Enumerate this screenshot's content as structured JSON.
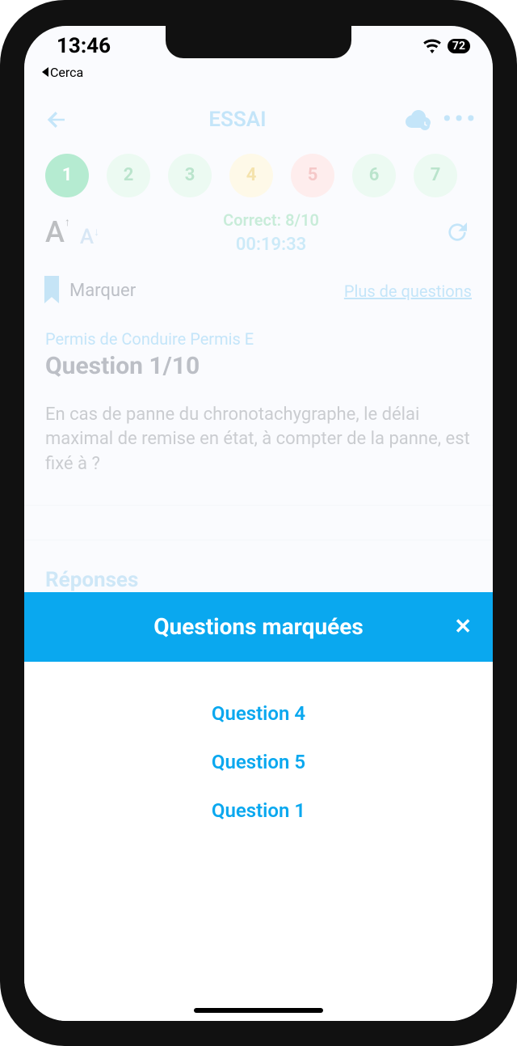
{
  "status": {
    "time": "13:46",
    "battery": "72",
    "back_app": "Cerca"
  },
  "header": {
    "title": "ESSAI"
  },
  "pills": [
    {
      "n": "1",
      "cls": "pill-solid"
    },
    {
      "n": "2",
      "cls": "pill-g"
    },
    {
      "n": "3",
      "cls": "pill-g"
    },
    {
      "n": "4",
      "cls": "pill-y"
    },
    {
      "n": "5",
      "cls": "pill-r"
    },
    {
      "n": "6",
      "cls": "pill-g"
    },
    {
      "n": "7",
      "cls": "pill-g"
    }
  ],
  "stats": {
    "correct": "Correct: 8/10",
    "timer": "00:19:33"
  },
  "mark": {
    "label": "Marquer",
    "more": "Plus de questions"
  },
  "question": {
    "category": "Permis de Conduire Permis E",
    "title": "Question 1/10",
    "text": "En cas de panne du chronotachygraphe, le délai maximal de remise en état, à compter de la panne, est fixé à ?"
  },
  "answers": {
    "header": "Réponses"
  },
  "sheet": {
    "title": "Questions marquées",
    "items": [
      "Question 4",
      "Question 5",
      "Question 1"
    ]
  }
}
